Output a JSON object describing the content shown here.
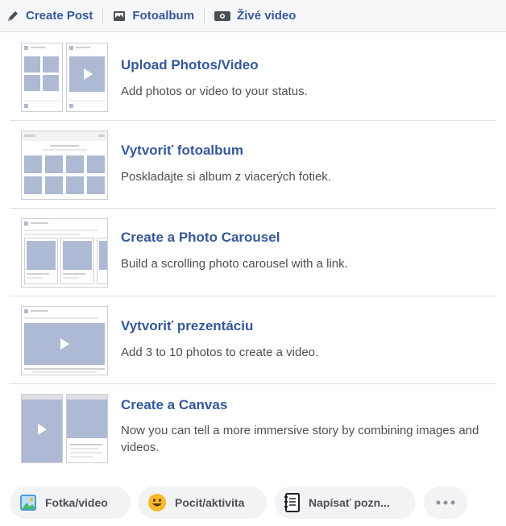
{
  "toolbar": {
    "create_post": {
      "label": "Create Post",
      "icon": "pencil-icon"
    },
    "photo_album": {
      "label": "Fotoalbum",
      "icon": "photo-album-icon"
    },
    "live_video": {
      "label": "Živé video",
      "icon": "live-video-icon"
    }
  },
  "options": [
    {
      "title": "Upload Photos/Video",
      "description": "Add photos or video to your status."
    },
    {
      "title": "Vytvoriť fotoalbum",
      "description": "Poskladajte si album z viacerých fotiek."
    },
    {
      "title": "Create a Photo Carousel",
      "description": "Build a scrolling photo carousel with a link."
    },
    {
      "title": "Vytvoriť prezentáciu",
      "description": "Add 3 to 10 photos to create a video."
    },
    {
      "title": "Create a Canvas",
      "description": "Now you can tell a more immersive story by combining images and videos."
    }
  ],
  "bottom_actions": [
    {
      "label": "Fotka/video",
      "icon": "photo-icon"
    },
    {
      "label": "Pocit/aktivita",
      "icon": "smiley-icon"
    },
    {
      "label": "Napísať pozn...",
      "icon": "notebook-icon"
    },
    {
      "label": "",
      "icon": "more-icon"
    }
  ],
  "colors": {
    "link_blue": "#365899",
    "placeholder_blue": "#aeb9d4",
    "border": "#dddfe2",
    "pill_bg": "#f2f3f5"
  }
}
